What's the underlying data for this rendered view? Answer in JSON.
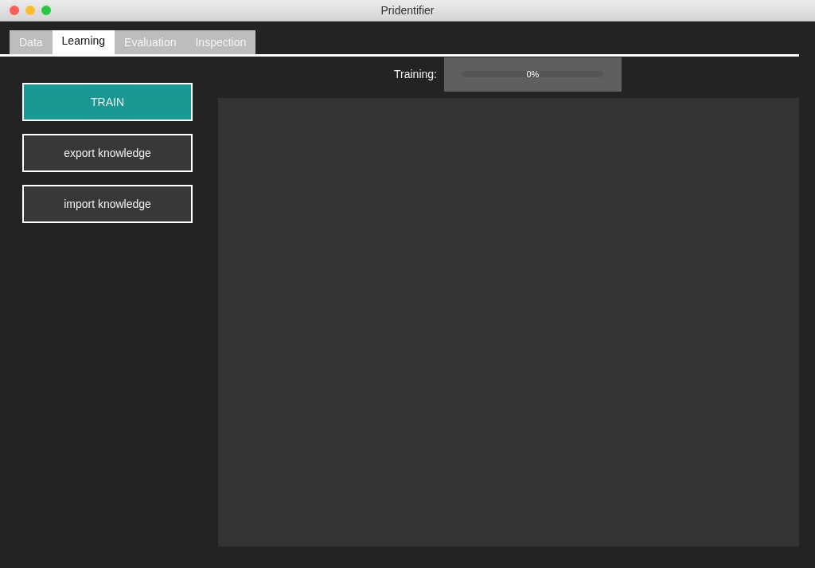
{
  "window": {
    "title": "Pridentifier"
  },
  "tabs": [
    {
      "label": "Data",
      "selected": false
    },
    {
      "label": "Learning",
      "selected": true
    },
    {
      "label": "Evaluation",
      "selected": false
    },
    {
      "label": "Inspection",
      "selected": false
    }
  ],
  "buttons": [
    {
      "label": "TRAIN",
      "highlighted": true
    },
    {
      "label": "export knowledge",
      "highlighted": false
    },
    {
      "label": "import knowledge",
      "highlighted": false
    }
  ],
  "training": {
    "label": "Training:",
    "level": 0,
    "reading": "0%"
  }
}
